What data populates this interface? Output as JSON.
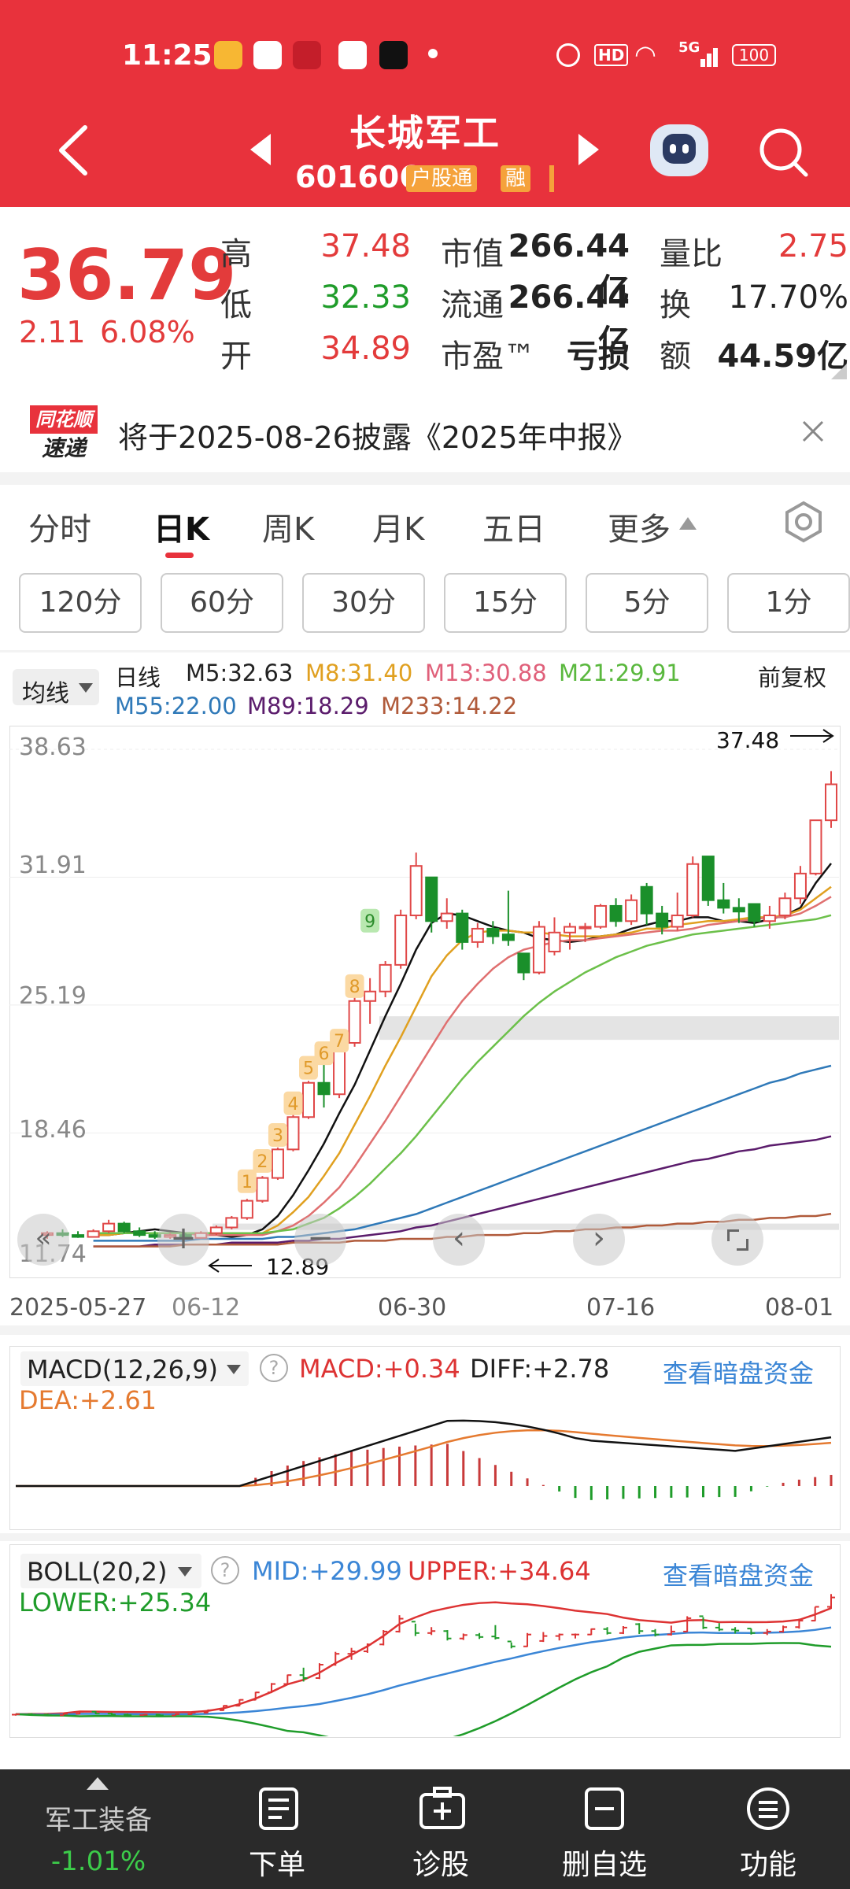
{
  "status_bar": {
    "time": "11:25",
    "battery": "100",
    "hd_label": "HD",
    "signal_label": "5G"
  },
  "header": {
    "title": "长城军工",
    "code": "601606",
    "tag1": "户股通",
    "tag2": "融"
  },
  "quote": {
    "price": "36.79",
    "change": "2.11",
    "change_pct": "6.08%",
    "stats": [
      {
        "label": "高",
        "value": "37.48",
        "color": "red"
      },
      {
        "label": "低",
        "value": "32.33",
        "color": "green"
      },
      {
        "label": "开",
        "value": "34.89",
        "color": "red"
      }
    ],
    "stats2": [
      {
        "label": "市值",
        "value": "266.44亿"
      },
      {
        "label": "流通",
        "value": "266.44亿"
      },
      {
        "label": "市盈™",
        "value": "亏损"
      }
    ],
    "stats3": [
      {
        "label": "量比",
        "value": "2.75",
        "color": "red"
      },
      {
        "label": "换",
        "value": "17.70%"
      },
      {
        "label": "额",
        "value": "44.59亿"
      }
    ]
  },
  "news": {
    "logo_top": "同花顺",
    "logo_bottom": "速递",
    "text": "将于2025-08-26披露《2025年中报》"
  },
  "tabs": [
    "分时",
    "日K",
    "周K",
    "月K",
    "五日",
    "更多"
  ],
  "active_tab": "日K",
  "periods": [
    "120分",
    "60分",
    "30分",
    "15分",
    "5分",
    "1分"
  ],
  "ma_legend": {
    "selector": "均线",
    "type": "日线",
    "m5": "M5:32.63",
    "m8": "M8:31.40",
    "m13": "M13:30.88",
    "m21": "M21:29.91",
    "m55": "M55:22.00",
    "m89": "M89:18.29",
    "m233": "M233:14.22",
    "adjust": "前复权"
  },
  "kline": {
    "y_labels": [
      "38.63",
      "31.91",
      "25.19",
      "18.46",
      "11.74"
    ],
    "high_marker": "37.48",
    "low_marker": "12.89",
    "x_labels": [
      "2025-05-27",
      "06-12",
      "06-30",
      "07-16",
      "08-01"
    ],
    "signal_numbers": [
      "1",
      "2",
      "3",
      "4",
      "5",
      "6",
      "7",
      "8",
      "9"
    ]
  },
  "chart_data": {
    "type": "candlestick",
    "y_range": [
      11.74,
      38.63
    ],
    "candles": [
      [
        13.1,
        13.3,
        12.9,
        13.2
      ],
      [
        13.2,
        13.4,
        13.0,
        13.1
      ],
      [
        13.1,
        13.3,
        12.95,
        13.0
      ],
      [
        13.0,
        13.4,
        13.0,
        13.3
      ],
      [
        13.3,
        13.9,
        13.2,
        13.7
      ],
      [
        13.7,
        13.8,
        13.2,
        13.3
      ],
      [
        13.3,
        13.5,
        13.0,
        13.1
      ],
      [
        13.1,
        13.3,
        12.9,
        13.0
      ],
      [
        13.0,
        13.2,
        12.9,
        13.1
      ],
      [
        13.1,
        13.2,
        12.89,
        12.95
      ],
      [
        12.95,
        13.3,
        12.9,
        13.2
      ],
      [
        13.2,
        13.6,
        13.1,
        13.5
      ],
      [
        13.5,
        14.1,
        13.4,
        14.0
      ],
      [
        14.0,
        15.0,
        13.9,
        14.9
      ],
      [
        14.9,
        16.2,
        14.8,
        16.1
      ],
      [
        16.1,
        17.7,
        16.0,
        17.6
      ],
      [
        17.6,
        19.5,
        17.5,
        19.3
      ],
      [
        19.3,
        21.2,
        19.2,
        21.1
      ],
      [
        21.1,
        22.6,
        19.8,
        20.5
      ],
      [
        20.5,
        23.5,
        20.3,
        23.2
      ],
      [
        23.2,
        25.8,
        23.0,
        25.4
      ],
      [
        25.4,
        26.6,
        24.2,
        25.9
      ],
      [
        25.9,
        27.5,
        25.6,
        27.3
      ],
      [
        27.3,
        30.2,
        27.1,
        29.9
      ],
      [
        29.9,
        33.2,
        29.7,
        32.5
      ],
      [
        31.9,
        31.5,
        29.0,
        29.6
      ],
      [
        29.6,
        30.8,
        29.2,
        30.0
      ],
      [
        30.0,
        30.2,
        28.1,
        28.5
      ],
      [
        28.5,
        29.5,
        28.2,
        29.2
      ],
      [
        29.2,
        29.6,
        28.4,
        28.8
      ],
      [
        28.9,
        31.2,
        28.3,
        28.6
      ],
      [
        27.9,
        27.7,
        26.5,
        26.9
      ],
      [
        26.9,
        29.6,
        26.8,
        29.3
      ],
      [
        28.0,
        29.8,
        27.8,
        29.0
      ],
      [
        29.0,
        29.5,
        28.1,
        29.3
      ],
      [
        29.3,
        29.5,
        28.5,
        29.3
      ],
      [
        29.3,
        30.5,
        29.2,
        30.4
      ],
      [
        30.4,
        30.8,
        29.3,
        29.6
      ],
      [
        29.6,
        31.0,
        29.4,
        30.7
      ],
      [
        31.4,
        31.6,
        29.4,
        30.0
      ],
      [
        30.0,
        30.4,
        28.9,
        29.3
      ],
      [
        29.3,
        31.1,
        29.1,
        29.9
      ],
      [
        29.9,
        33.0,
        29.8,
        32.6
      ],
      [
        33.0,
        32.8,
        30.4,
        30.7
      ],
      [
        30.7,
        31.6,
        30.0,
        30.3
      ],
      [
        30.3,
        30.8,
        29.5,
        30.1
      ],
      [
        30.5,
        30.5,
        29.3,
        29.6
      ],
      [
        29.6,
        30.4,
        29.2,
        29.9
      ],
      [
        29.9,
        31.1,
        29.7,
        30.8
      ],
      [
        30.8,
        32.5,
        30.5,
        32.1
      ],
      [
        32.1,
        34.9,
        32.0,
        34.9
      ],
      [
        34.9,
        37.48,
        34.5,
        36.79
      ]
    ],
    "ma_names": [
      "M5",
      "M8",
      "M13",
      "M21",
      "M55",
      "M89",
      "M233"
    ],
    "series": [
      {
        "name": "M5",
        "color": "#111111",
        "values": [
          13.1,
          13.1,
          13.2,
          13.3,
          13.4,
          13.3,
          13.2,
          13.1,
          13.1,
          13.0,
          13.1,
          13.4,
          14.1,
          15.2,
          16.5,
          17.9,
          19.5,
          21.0,
          22.8,
          24.6,
          26.3,
          28.1,
          29.5,
          30.0,
          29.9,
          29.6,
          29.3,
          29.1,
          29.0,
          28.7,
          28.6,
          28.5,
          28.6,
          28.8,
          28.9,
          29.2,
          29.4,
          29.6,
          29.6,
          29.8,
          29.8,
          29.6,
          29.6,
          29.5,
          29.7,
          29.9,
          30.3,
          31.6,
          32.63
        ]
      },
      {
        "name": "M8",
        "color": "#e0a020",
        "values": [
          13.1,
          13.1,
          13.2,
          13.2,
          13.2,
          13.2,
          13.2,
          13.1,
          13.1,
          13.1,
          13.1,
          13.2,
          13.6,
          14.3,
          15.1,
          16.2,
          17.4,
          18.9,
          20.4,
          22.0,
          23.5,
          25.1,
          26.7,
          27.8,
          28.6,
          29.0,
          29.1,
          29.1,
          29.0,
          29.0,
          28.9,
          28.8,
          28.8,
          28.8,
          28.9,
          29.0,
          29.2,
          29.2,
          29.4,
          29.5,
          29.6,
          29.6,
          29.7,
          29.8,
          29.8,
          29.9,
          30.2,
          30.8,
          31.4
        ]
      },
      {
        "name": "M13",
        "color": "#e07070",
        "values": [
          13.2,
          13.2,
          13.2,
          13.2,
          13.2,
          13.2,
          13.2,
          13.1,
          13.1,
          13.1,
          13.1,
          13.1,
          13.3,
          13.6,
          14.1,
          14.8,
          15.6,
          16.7,
          17.9,
          19.1,
          20.4,
          21.7,
          23.0,
          24.3,
          25.4,
          26.3,
          27.1,
          27.7,
          28.1,
          28.3,
          28.5,
          28.6,
          28.6,
          28.7,
          28.8,
          28.9,
          29.0,
          29.1,
          29.1,
          29.2,
          29.4,
          29.5,
          29.6,
          29.7,
          29.8,
          29.8,
          30.0,
          30.4,
          30.88
        ]
      },
      {
        "name": "M21",
        "color": "#6cc04a",
        "values": [
          13.2,
          13.2,
          13.2,
          13.2,
          13.2,
          13.2,
          13.2,
          13.2,
          13.2,
          13.2,
          13.2,
          13.2,
          13.3,
          13.4,
          13.7,
          14.0,
          14.5,
          15.1,
          15.8,
          16.6,
          17.4,
          18.3,
          19.3,
          20.3,
          21.3,
          22.2,
          23.0,
          23.8,
          24.6,
          25.3,
          25.9,
          26.4,
          26.9,
          27.3,
          27.7,
          28.0,
          28.3,
          28.5,
          28.7,
          28.9,
          29.0,
          29.1,
          29.2,
          29.3,
          29.4,
          29.5,
          29.6,
          29.7,
          29.91
        ]
      },
      {
        "name": "M55",
        "color": "#2f79b8",
        "values": [
          12.8,
          12.8,
          12.8,
          12.8,
          12.8,
          12.8,
          12.8,
          12.9,
          12.9,
          12.9,
          12.9,
          12.9,
          13.0,
          13.0,
          13.1,
          13.2,
          13.3,
          13.4,
          13.6,
          13.8,
          14.0,
          14.2,
          14.5,
          14.8,
          15.1,
          15.4,
          15.7,
          16.0,
          16.3,
          16.6,
          16.9,
          17.2,
          17.5,
          17.8,
          18.1,
          18.4,
          18.7,
          19.0,
          19.3,
          19.6,
          19.9,
          20.2,
          20.5,
          20.8,
          21.1,
          21.3,
          21.6,
          21.8,
          22.0
        ]
      },
      {
        "name": "M89",
        "color": "#5b1c6c",
        "values": [
          12.5,
          12.5,
          12.5,
          12.5,
          12.6,
          12.6,
          12.6,
          12.6,
          12.6,
          12.7,
          12.7,
          12.7,
          12.7,
          12.8,
          12.8,
          12.9,
          12.9,
          13.0,
          13.1,
          13.2,
          13.3,
          13.5,
          13.6,
          13.8,
          14.0,
          14.2,
          14.4,
          14.6,
          14.8,
          15.0,
          15.2,
          15.4,
          15.6,
          15.8,
          16.0,
          16.2,
          16.4,
          16.6,
          16.8,
          17.0,
          17.1,
          17.3,
          17.5,
          17.6,
          17.8,
          17.9,
          18.0,
          18.1,
          18.29
        ]
      },
      {
        "name": "M233",
        "color": "#b05a3a",
        "values": [
          12.5,
          12.5,
          12.5,
          12.5,
          12.5,
          12.5,
          12.6,
          12.6,
          12.6,
          12.6,
          12.6,
          12.6,
          12.6,
          12.7,
          12.7,
          12.7,
          12.7,
          12.8,
          12.8,
          12.8,
          12.9,
          12.9,
          12.9,
          13.0,
          13.0,
          13.1,
          13.1,
          13.1,
          13.2,
          13.2,
          13.3,
          13.3,
          13.4,
          13.4,
          13.5,
          13.5,
          13.6,
          13.6,
          13.7,
          13.7,
          13.8,
          13.8,
          13.9,
          13.9,
          14.0,
          14.0,
          14.1,
          14.1,
          14.22
        ]
      }
    ]
  },
  "macd": {
    "title": "MACD(12,26,9)",
    "macd": "MACD:+0.34",
    "diff": "DIFF:+2.78",
    "dea": "DEA:+2.61",
    "link": "查看暗盘资金"
  },
  "boll": {
    "title": "BOLL(20,2)",
    "mid": "MID:+29.99",
    "upper": "UPPER:+34.64",
    "lower": "LOWER:+25.34",
    "link": "查看暗盘资金"
  },
  "bottom_nav": {
    "sector_name": "军工装备",
    "sector_change": "-1.01%",
    "items": [
      "下单",
      "诊股",
      "删自选",
      "功能"
    ]
  }
}
